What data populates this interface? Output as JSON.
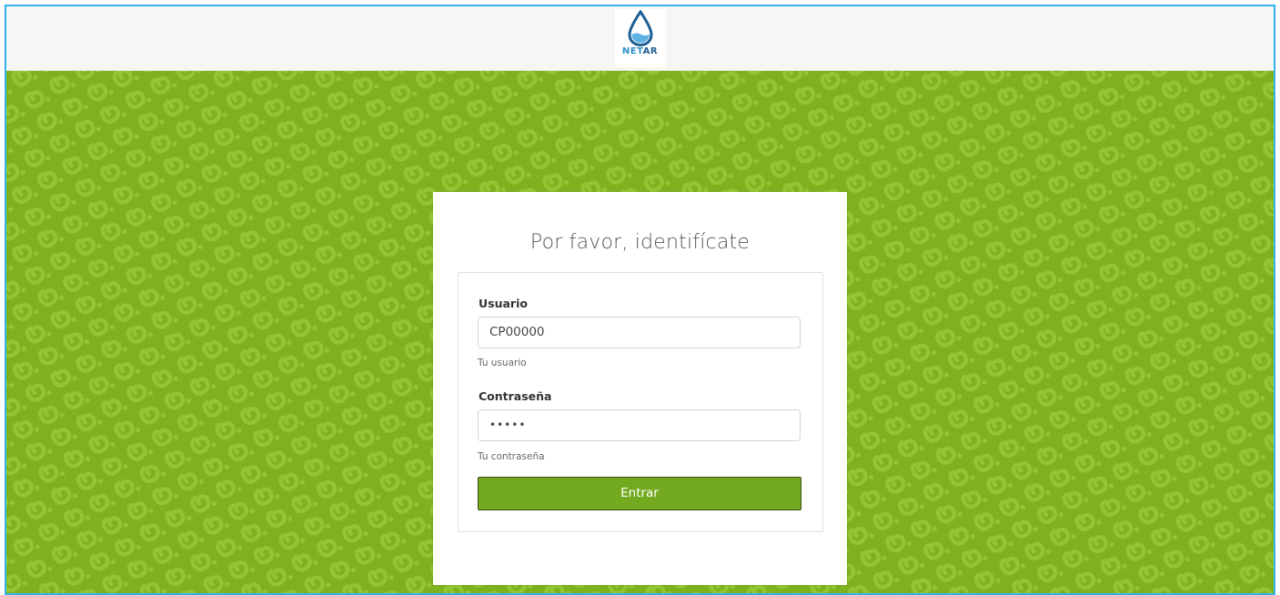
{
  "header": {
    "logo": {
      "icon": "water-drop-icon",
      "text_part1": "NET",
      "text_part2": "AR"
    }
  },
  "login": {
    "title": "Por favor, identifícate",
    "username": {
      "label": "Usuario",
      "value": "CP00000",
      "help": "Tu usuario"
    },
    "password": {
      "label": "Contraseña",
      "value": "•••••",
      "help": "Tu contraseña"
    },
    "submit_label": "Entrar"
  },
  "colors": {
    "background_green": "#7fb11f",
    "pattern_green": "#91c42e",
    "button_green": "#74aa20",
    "frame_border": "#35b3e6",
    "logo_blue": "#2e8fc8",
    "logo_dark_blue": "#1d5f93"
  }
}
